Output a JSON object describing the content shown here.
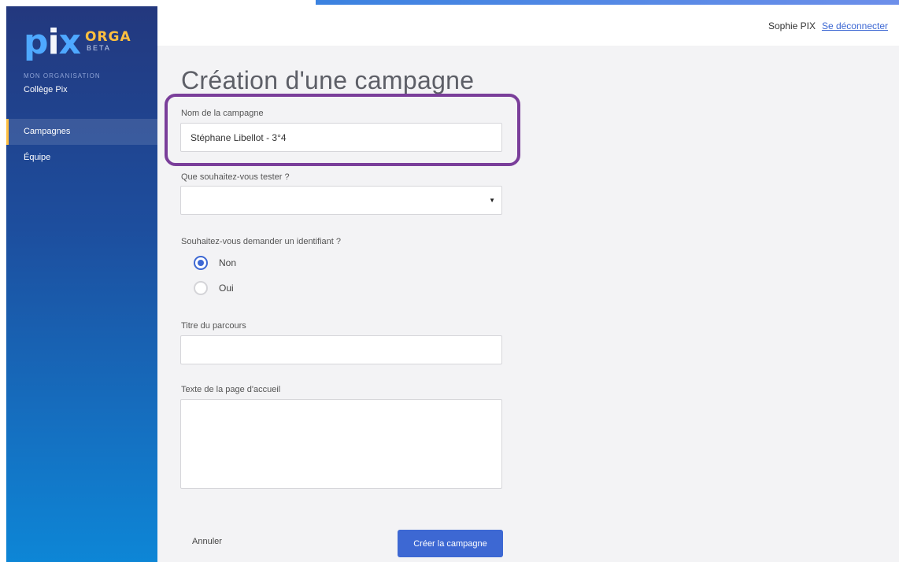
{
  "brand": {
    "logo_letters": [
      "p",
      "i",
      "x"
    ],
    "logo_orga": "ORGA",
    "logo_beta": "BETA",
    "colors": {
      "accent": "#3d68d3",
      "brand_yellow": "#ffbf3f",
      "highlight": "#7a3e9a"
    }
  },
  "sidebar": {
    "org_caption": "MON ORGANISATION",
    "org_name": "Collège Pix",
    "items": [
      {
        "label": "Campagnes",
        "active": true
      },
      {
        "label": "Équipe",
        "active": false
      }
    ]
  },
  "topbar": {
    "user_name": "Sophie PIX",
    "logout_label": "Se déconnecter"
  },
  "form": {
    "title": "Création d'une campagne",
    "campaign_name": {
      "label": "Nom de la campagne",
      "value": "Stéphane Libellot - 3°4"
    },
    "test_select": {
      "label": "Que souhaitez-vous tester ?",
      "value": ""
    },
    "identifier": {
      "label": "Souhaitez-vous demander un identifiant ?",
      "options": [
        {
          "label": "Non",
          "checked": true
        },
        {
          "label": "Oui",
          "checked": false
        }
      ]
    },
    "course_title": {
      "label": "Titre du parcours",
      "value": ""
    },
    "welcome_text": {
      "label": "Texte de la page d'accueil",
      "value": ""
    },
    "cancel_label": "Annuler",
    "submit_label": "Créer la campagne"
  }
}
